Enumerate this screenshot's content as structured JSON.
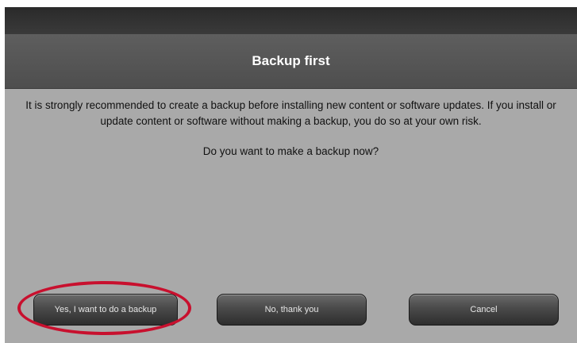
{
  "dialog": {
    "title": "Backup first",
    "message": "It is strongly recommended to create a backup before installing new content or software updates. If you install or update content or software without making a backup, you do so at your own risk.",
    "question": "Do you want to make a backup now?",
    "buttons": {
      "yes": "Yes, I want to do a backup",
      "no": "No, thank you",
      "cancel": "Cancel"
    }
  },
  "colors": {
    "header": "#555555",
    "background": "#a9a9a9",
    "highlight": "#c8102e"
  }
}
